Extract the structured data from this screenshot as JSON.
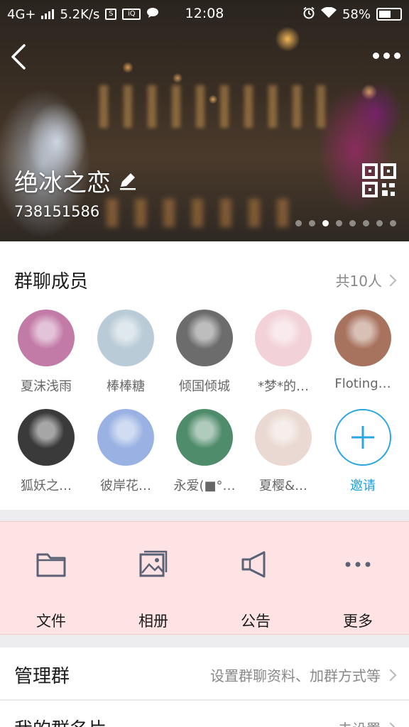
{
  "status_bar": {
    "network": "4G+",
    "speed": "5.2K/s",
    "time": "12:08",
    "battery": "58%",
    "battery_level": 0.58
  },
  "header": {
    "group_name": "绝冰之恋",
    "group_id": "738151586",
    "page_dots": 8,
    "active_dot": 3
  },
  "members": {
    "title": "群聊成员",
    "count": "共10人",
    "items": [
      {
        "name": "夏沫浅雨",
        "color": "#c27aa6"
      },
      {
        "name": "棒棒糖",
        "color": "#b9cbd6"
      },
      {
        "name": "倾国倾城",
        "color": "#6c6c6c"
      },
      {
        "name": "*梦*的…",
        "color": "#f2d2d8"
      },
      {
        "name": "Floting…",
        "color": "#a8735e"
      },
      {
        "name": "狐妖之…",
        "color": "#3a3a3a"
      },
      {
        "name": "彼岸花…",
        "color": "#9ab2e3"
      },
      {
        "name": "永爱(■°…",
        "color": "#4f8c6b"
      },
      {
        "name": "夏樱&…",
        "color": "#ead9d2"
      }
    ],
    "invite_label": "邀请"
  },
  "actions": [
    {
      "label": "文件",
      "icon": "folder-icon"
    },
    {
      "label": "相册",
      "icon": "album-icon"
    },
    {
      "label": "公告",
      "icon": "megaphone-icon"
    },
    {
      "label": "更多",
      "icon": "more-dots-icon"
    }
  ],
  "rows": [
    {
      "label": "管理群",
      "value": "设置群聊资料、加群方式等"
    },
    {
      "label": "我的群名片",
      "value": "未设置"
    }
  ],
  "colors": {
    "accent": "#1aa0dd",
    "actions_bg": "#fde3e4"
  }
}
